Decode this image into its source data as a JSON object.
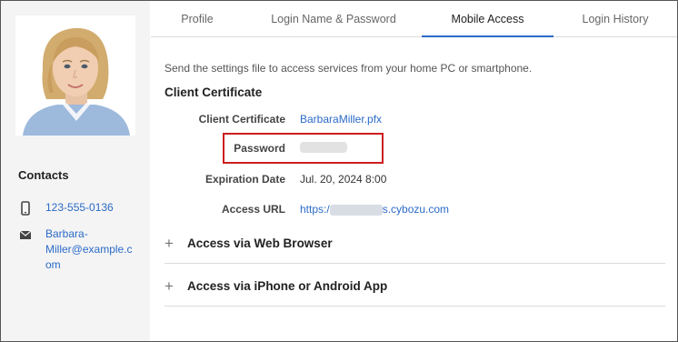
{
  "tabs": [
    {
      "label": "Profile",
      "active": false
    },
    {
      "label": "Login Name & Password",
      "active": false
    },
    {
      "label": "Mobile Access",
      "active": true
    },
    {
      "label": "Login History",
      "active": false
    }
  ],
  "sidebar": {
    "contacts_title": "Contacts",
    "phone": {
      "icon": "phone-icon",
      "value": "123-555-0136"
    },
    "email": {
      "icon": "mail-icon",
      "line1": "Barbara-",
      "line2": "Miller@example.c",
      "line3": "om"
    }
  },
  "mobile_access": {
    "intro": "Send the settings file to access services from your home PC or smartphone.",
    "section_title": "Client Certificate",
    "fields": {
      "certificate": {
        "label": "Client Certificate",
        "value": "BarbaraMiller.pfx"
      },
      "password": {
        "label": "Password"
      },
      "expiration": {
        "label": "Expiration Date",
        "value": "Jul. 20, 2024 8:00"
      },
      "access_url": {
        "label": "Access URL",
        "prefix": "https:/",
        "suffix": "s.cybozu.com"
      }
    },
    "accordions": [
      {
        "label": "Access via Web Browser",
        "icon": "plus-icon"
      },
      {
        "label": "Access via iPhone or Android App",
        "icon": "plus-icon"
      }
    ]
  },
  "colors": {
    "link": "#2b6bc7",
    "highlight": "#cc1f1f",
    "sidebar_bg": "#f4f4f4"
  }
}
